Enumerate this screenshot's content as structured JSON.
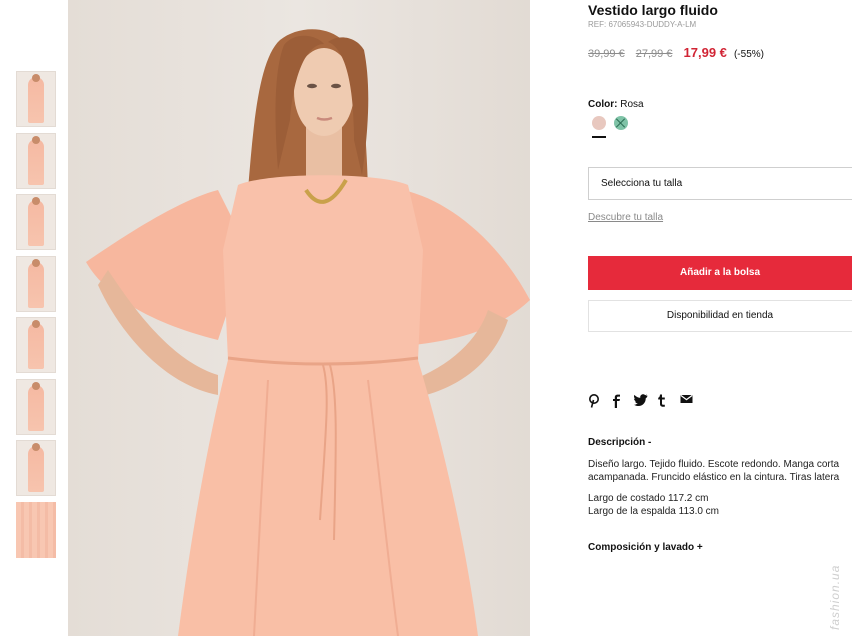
{
  "product": {
    "title": "Vestido largo fluido",
    "ref": "REF: 67065943-DUDDY-A-LM",
    "price_original": "39,99 €",
    "price_previous": "27,99 €",
    "price_current": "17,99 €",
    "discount": "(-55%)"
  },
  "color": {
    "label": "Color:",
    "value": "Rosa",
    "swatches": [
      "#e8c8bf",
      "#7fc3a7"
    ]
  },
  "size": {
    "placeholder": "Selecciona tu talla",
    "guide_link": "Descubre tu talla"
  },
  "actions": {
    "add_to_bag": "Añadir a la bolsa",
    "store_availability": "Disponibilidad en tienda"
  },
  "share_icons": [
    "pinterest-icon",
    "facebook-icon",
    "twitter-icon",
    "tumblr-icon",
    "email-icon"
  ],
  "description": {
    "title": "Descripción  -",
    "line1": "Diseño largo. Tejido fluido. Escote redondo. Manga corta",
    "line2": "acampanada. Fruncido elástico en la cintura. Tiras latera",
    "measure1": "Largo de costado 117.2 cm",
    "measure2": "Largo de la espalda 113.0 cm"
  },
  "composition": {
    "title": "Composición y lavado  +"
  },
  "gallery": {
    "thumbnail_count": 8
  },
  "watermark": "fashion.ua",
  "colors": {
    "accent": "#e62a3b",
    "sale_price": "#d12434",
    "dress": "#f8bda5"
  }
}
